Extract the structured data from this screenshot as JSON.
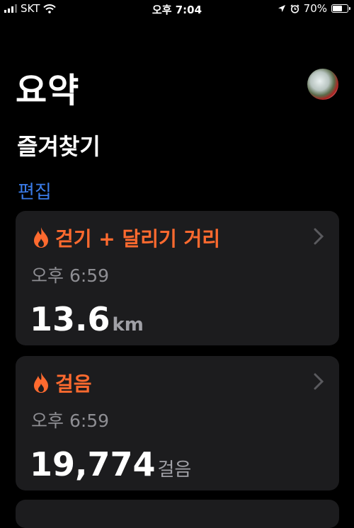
{
  "status_bar": {
    "carrier": "SKT",
    "time": "오후 7:04",
    "battery": "70%",
    "battery_level": 0.7
  },
  "header": {
    "title": "요약",
    "avatar_icon": "profile-avatar"
  },
  "favorites": {
    "title": "즐겨찾기",
    "edit_label": "편집"
  },
  "cards": [
    {
      "title": "걷기 + 달리기 거리",
      "time": "오후 6:59",
      "value": "13.6",
      "unit": "km",
      "icon": "flame-icon"
    },
    {
      "title": "걸음",
      "time": "오후 6:59",
      "value": "19,774",
      "unit": "걸음",
      "icon": "flame-icon"
    }
  ],
  "colors": {
    "accent_orange": "#ff6a2f",
    "link_blue": "#3a7be8",
    "card_bg": "#1c1c1e",
    "secondary_text": "#8e8e93"
  }
}
